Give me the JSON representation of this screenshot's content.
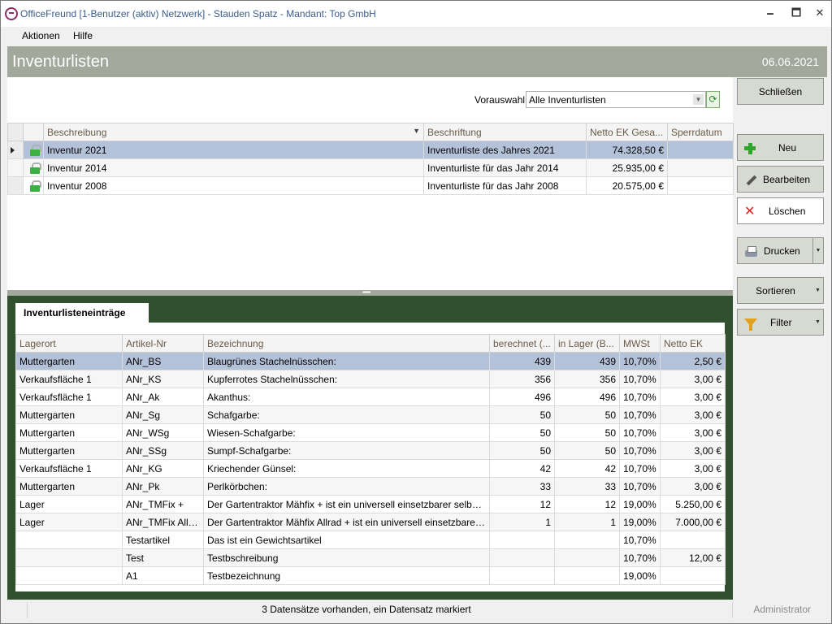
{
  "window": {
    "title": "OfficeFreund [1-Benutzer (aktiv) Netzwerk]  -  Stauden Spatz  -  Mandant: Top GmbH",
    "minimize": "🗕",
    "maximize": "🗖",
    "close": "✕"
  },
  "menu": {
    "aktionen": "Aktionen",
    "hilfe": "Hilfe"
  },
  "header": {
    "title": "Inventurlisten",
    "date": "06.06.2021"
  },
  "vorauswahl": {
    "label": "Vorauswahl:",
    "value": "Alle Inventurlisten"
  },
  "lists": {
    "columns": [
      "Beschreibung",
      "Beschriftung",
      "Netto  EK Gesa...",
      "Sperrdatum"
    ],
    "rows": [
      [
        "Inventur 2021",
        "Inventurliste des Jahres 2021",
        "74.328,50 €",
        ""
      ],
      [
        "Inventur 2014",
        "Inventurliste für das Jahr 2014",
        "25.935,00 €",
        ""
      ],
      [
        "Inventur 2008",
        "Inventurliste für das Jahr 2008",
        "20.575,00 €",
        ""
      ]
    ],
    "selected_row": 0
  },
  "entries": {
    "tab_label": "Inventurlisteneinträge",
    "columns": [
      "Lagerort",
      "Artikel-Nr",
      "Bezeichnung",
      "berechnet (...",
      "in Lager (B...",
      "MWSt",
      "Netto EK"
    ],
    "rows": [
      [
        "Muttergarten",
        "ANr_BS",
        "Blaugrünes Stachelnüsschen:",
        "439",
        "439",
        "10,70%",
        "2,50 €"
      ],
      [
        "Verkaufsfläche 1",
        "ANr_KS",
        "Kupferrotes Stachelnüsschen:",
        "356",
        "356",
        "10,70%",
        "3,00 €"
      ],
      [
        "Verkaufsfläche 1",
        "ANr_Ak",
        "Akanthus:",
        "496",
        "496",
        "10,70%",
        "3,00 €"
      ],
      [
        "Muttergarten",
        "ANr_Sg",
        "Schafgarbe:",
        "50",
        "50",
        "10,70%",
        "3,00 €"
      ],
      [
        "Muttergarten",
        "ANr_WSg",
        "Wiesen-Schafgarbe:",
        "50",
        "50",
        "10,70%",
        "3,00 €"
      ],
      [
        "Muttergarten",
        "ANr_SSg",
        "Sumpf-Schafgarbe:",
        "50",
        "50",
        "10,70%",
        "3,00 €"
      ],
      [
        "Verkaufsfläche 1",
        "ANr_KG",
        "Kriechender Günsel:",
        "42",
        "42",
        "10,70%",
        "3,00 €"
      ],
      [
        "Muttergarten",
        "ANr_Pk",
        "Perlkörbchen:",
        "33",
        "33",
        "10,70%",
        "3,00 €"
      ],
      [
        "Lager",
        "ANr_TMFix +",
        "Der Gartentraktor Mähfix  + ist ein universell einsetzbarer selbstfahrender Aufsitzmäher",
        "12",
        "12",
        "19,00%",
        "5.250,00 €"
      ],
      [
        "Lager",
        "ANr_TMFix Allrad",
        "Der Gartentraktor Mähfix Allrad + ist ein universell einsetzbarer Aufsitzmäher",
        "1",
        "1",
        "19,00%",
        "7.000,00 €"
      ],
      [
        "",
        "Testartikel",
        "Das ist ein Gewichtsartikel",
        "",
        "",
        "10,70%",
        ""
      ],
      [
        "",
        "Test",
        "Testbschreibung",
        "",
        "",
        "10,70%",
        "12,00 €"
      ],
      [
        "",
        "A1",
        "Testbezeichnung",
        "",
        "",
        "19,00%",
        ""
      ]
    ],
    "selected_row": 0
  },
  "actions": {
    "close": "Schließen",
    "new": "Neu",
    "edit": "Bearbeiten",
    "delete": "Löschen",
    "print": "Drucken",
    "sort": "Sortieren",
    "filter": "Filter"
  },
  "status": {
    "text": "3 Datensätze vorhanden, ein Datensatz markiert",
    "user": "Administrator"
  },
  "colors": {
    "accent_band": "#a3a89c",
    "detail_frame": "#30502f",
    "selection": "#b4c2d9"
  }
}
